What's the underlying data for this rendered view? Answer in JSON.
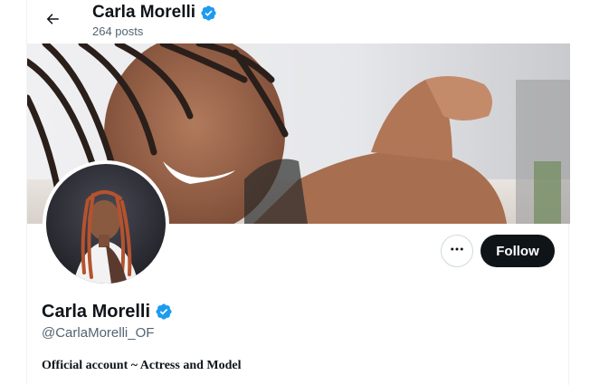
{
  "header": {
    "title": "Carla Morelli",
    "posts_count": "264 posts"
  },
  "profile": {
    "display_name": "Carla Morelli",
    "handle": "@CarlaMorelli_OF",
    "bio": "Official account ~ Actress and Model",
    "verified": true
  },
  "actions": {
    "follow_label": "Follow"
  },
  "icons": {
    "back": "arrow-left-icon",
    "verified": "verified-badge-icon",
    "more": "more-horizontal-icon"
  },
  "colors": {
    "verified_blue": "#1d9bf0",
    "follow_button_bg": "#0f1419",
    "secondary_text": "#536471"
  }
}
